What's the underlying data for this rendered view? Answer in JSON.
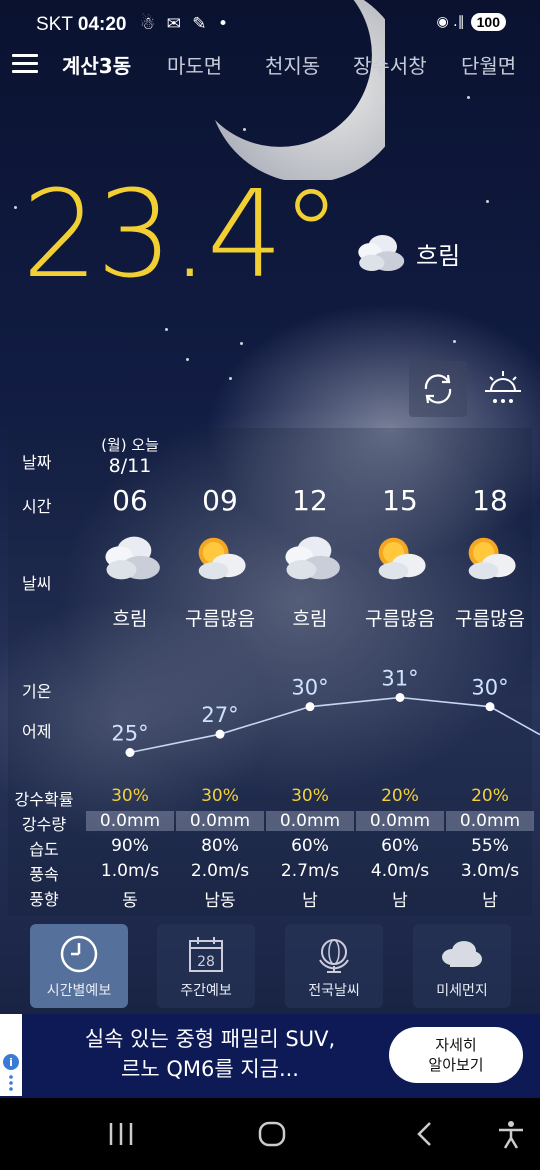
{
  "status": {
    "carrier": "SKT",
    "time": "04:20",
    "notif_icons": "☃ ✉ ✎ •",
    "signal": "◉ .∥",
    "battery": "100"
  },
  "nav": {
    "locations": [
      {
        "label": "계산3동",
        "active": true
      },
      {
        "label": "마도면"
      },
      {
        "label": "천지동"
      },
      {
        "label": "장수서창"
      },
      {
        "label": "단월면"
      }
    ]
  },
  "current": {
    "temp": "23.4°",
    "condition": "흐림"
  },
  "forecast": {
    "labels": {
      "date": "날짜",
      "time": "시간",
      "weather": "날씨",
      "temp": "기온",
      "yesterday": "어제"
    },
    "date_top": "(월) 오늘",
    "date_main": "8/11",
    "hours": [
      "06",
      "09",
      "12",
      "15",
      "18"
    ],
    "conditions": [
      "흐림",
      "구름많음",
      "흐림",
      "구름많음",
      "구름많음"
    ],
    "icons": [
      "cloudy-icon",
      "partly-cloudy-icon",
      "cloudy-icon",
      "partly-cloudy-icon",
      "partly-cloudy-icon"
    ],
    "temps": [
      25,
      27,
      30,
      31,
      30
    ],
    "temp_labels": [
      "25°",
      "27°",
      "30°",
      "31°",
      "30°"
    ]
  },
  "stats": {
    "labels": [
      "강수확률",
      "강수량",
      "습도",
      "풍속",
      "풍향"
    ],
    "precip_prob": [
      "30%",
      "30%",
      "30%",
      "20%",
      "20%"
    ],
    "precip_amt": [
      "0.0mm",
      "0.0mm",
      "0.0mm",
      "0.0mm",
      "0.0mm"
    ],
    "humidity": [
      "90%",
      "80%",
      "60%",
      "60%",
      "55%"
    ],
    "wind_speed": [
      "1.0m/s",
      "2.0m/s",
      "2.7m/s",
      "4.0m/s",
      "3.0m/s"
    ],
    "wind_dir": [
      "동",
      "남동",
      "남",
      "남",
      "남"
    ]
  },
  "tabs": [
    {
      "label": "시간별예보",
      "icon": "clock-icon",
      "active": true
    },
    {
      "label": "주간예보",
      "icon": "calendar-icon",
      "day": "28"
    },
    {
      "label": "전국날씨",
      "icon": "globe-icon"
    },
    {
      "label": "미세먼지",
      "icon": "cloud-icon"
    }
  ],
  "ad": {
    "line1": "실속 있는 중형 패밀리 SUV,",
    "line2": "르노 QM6를 지금...",
    "btn1": "자세히",
    "btn2": "알아보기"
  },
  "colors": {
    "temp_yellow": "#f2cf33",
    "active_tab": "#56709c",
    "ad_bg": "#0e1a55"
  }
}
